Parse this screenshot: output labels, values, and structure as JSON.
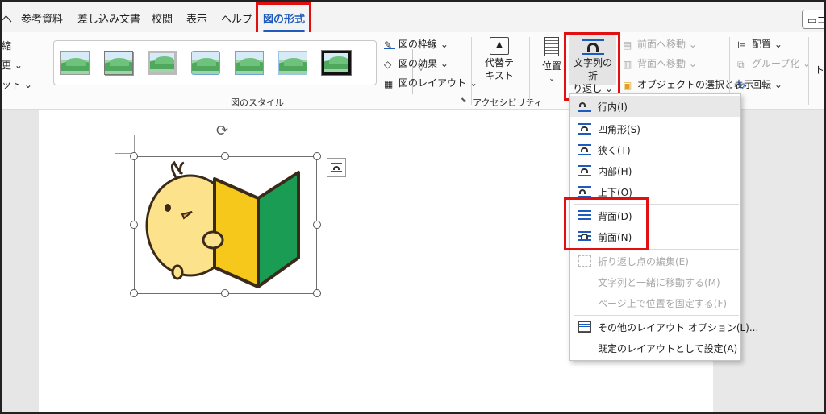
{
  "tabs": [
    {
      "label": "ヘ"
    },
    {
      "label": "参考資料"
    },
    {
      "label": "差し込み文書"
    },
    {
      "label": "校閲"
    },
    {
      "label": "表示"
    },
    {
      "label": "ヘルプ"
    },
    {
      "label": "図の形式",
      "active": true
    }
  ],
  "comment_button": "コ",
  "ribbon": {
    "left_partial": [
      "縮",
      "更 ⌄",
      "ット ⌄"
    ],
    "style_group_label": "図のスタイル",
    "style_commands": [
      "図の枠線 ⌄",
      "図の効果 ⌄",
      "図のレイアウト ⌄"
    ],
    "accessibility": {
      "button": "代替テ\nキスト",
      "group_label": "アクセシビリティ"
    },
    "position_label": "位置",
    "wrap_button": "文字列の折\nり返し ⌄",
    "arrange_commands": [
      "前面へ移動",
      "背面へ移動",
      "オブジェクトの選択と表示"
    ],
    "arrange_right": [
      "配置 ⌄",
      "グループ化 ⌄",
      "回転 ⌄"
    ],
    "far_right": "ト"
  },
  "wrap_menu": {
    "items": [
      {
        "label": "行内(I)",
        "icon": "inline-icon",
        "highlighted": true,
        "enabled": true
      },
      {
        "label": "四角形(S)",
        "icon": "square-wrap-icon",
        "enabled": true
      },
      {
        "label": "狭く(T)",
        "icon": "tight-wrap-icon",
        "enabled": true
      },
      {
        "label": "内部(H)",
        "icon": "through-wrap-icon",
        "enabled": true
      },
      {
        "label": "上下(O)",
        "icon": "top-bottom-wrap-icon",
        "enabled": true
      },
      {
        "label": "背面(D)",
        "icon": "behind-text-icon",
        "enabled": true
      },
      {
        "label": "前面(N)",
        "icon": "in-front-text-icon",
        "enabled": true
      },
      {
        "label": "折り返し点の編集(E)",
        "icon": "edit-wrap-points-icon",
        "enabled": false
      },
      {
        "label": "文字列と一緒に移動する(M)",
        "enabled": false
      },
      {
        "label": "ページ上で位置を固定する(F)",
        "enabled": false
      },
      {
        "label": "その他のレイアウト オプション(L)...",
        "icon": "layout-options-icon",
        "enabled": true
      },
      {
        "label": "既定のレイアウトとして設定(A)",
        "enabled": true
      }
    ]
  },
  "colors": {
    "accent": "#1e5bbf",
    "highlight_box": "#e01010",
    "chick_body": "#fde28c",
    "mark_yellow": "#f7c81c",
    "mark_green": "#1a9c55"
  }
}
